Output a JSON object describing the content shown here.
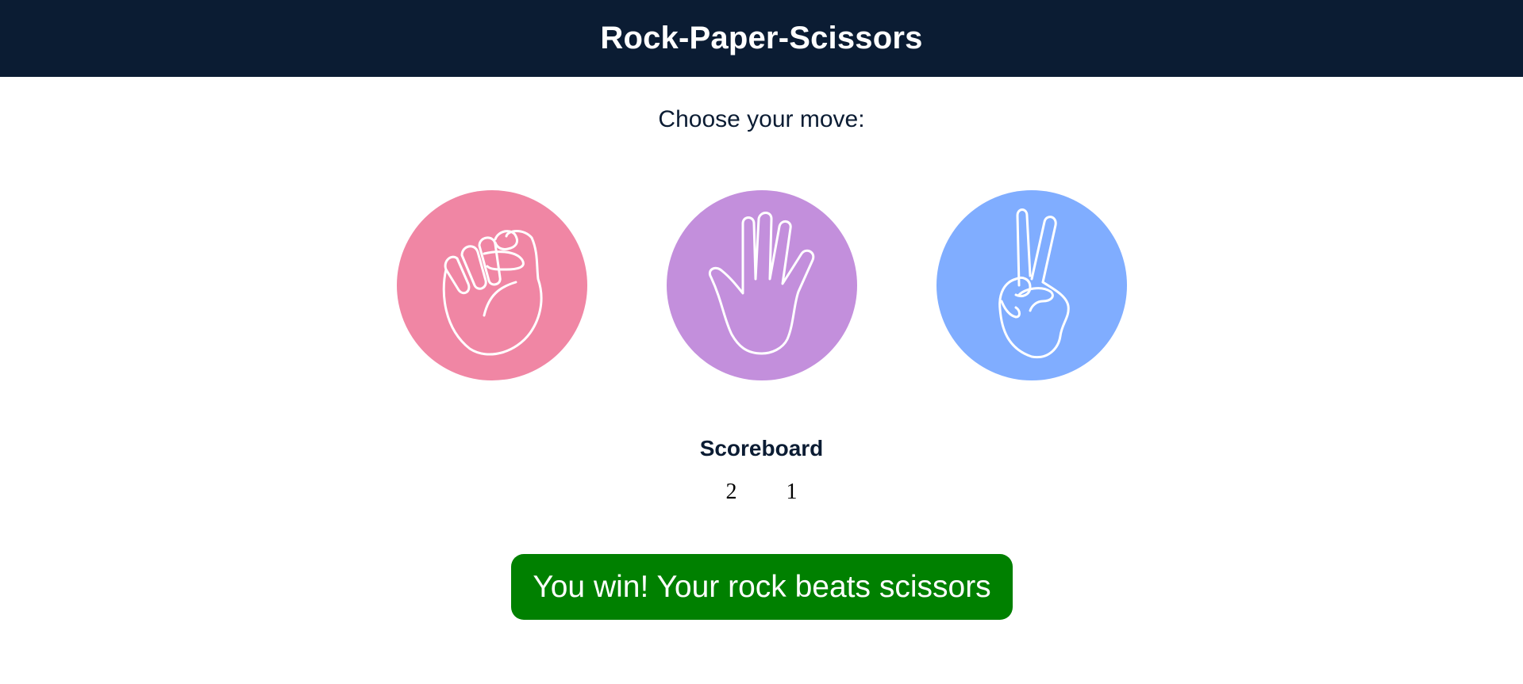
{
  "header": {
    "title": "Rock-Paper-Scissors"
  },
  "prompt": "Choose your move:",
  "moves": [
    {
      "id": "rock",
      "icon": "rock-fist-icon",
      "color": "#f086a4"
    },
    {
      "id": "paper",
      "icon": "paper-hand-icon",
      "color": "#c38fdc"
    },
    {
      "id": "scissors",
      "icon": "scissors-victory-hand-icon",
      "color": "#80adff"
    }
  ],
  "scoreboard": {
    "title": "Scoreboard",
    "player": "2",
    "computer": "1"
  },
  "result": {
    "message": "You win! Your rock beats scissors",
    "color": "#008000"
  },
  "colors": {
    "header_bg": "#0b1c33",
    "text": "#0b1c33"
  }
}
